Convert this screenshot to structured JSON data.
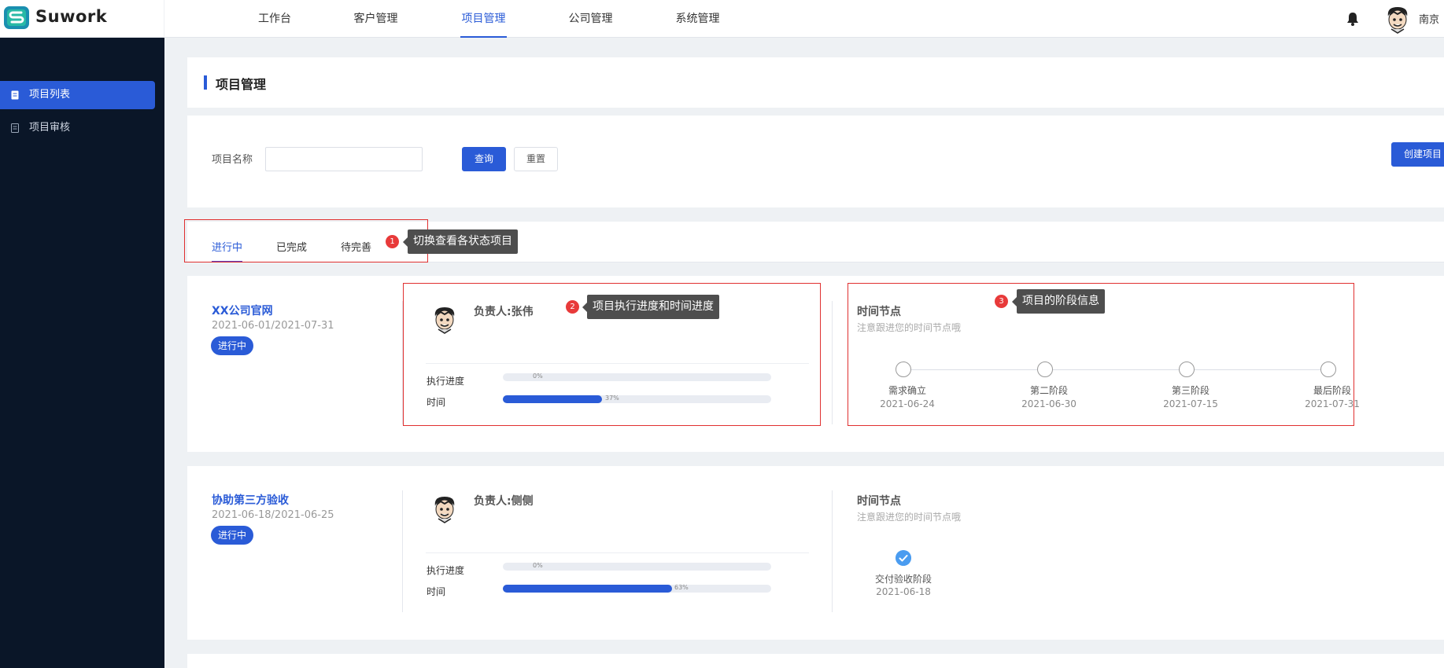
{
  "app": {
    "logo_text": "Suwork",
    "user_name": "南京"
  },
  "topnav": {
    "items": [
      {
        "label": "工作台",
        "active": false
      },
      {
        "label": "客户管理",
        "active": false
      },
      {
        "label": "项目管理",
        "active": true
      },
      {
        "label": "公司管理",
        "active": false
      },
      {
        "label": "系统管理",
        "active": false
      }
    ]
  },
  "sidebar": {
    "items": [
      {
        "label": "项目列表",
        "active": true
      },
      {
        "label": "项目审核",
        "active": false
      }
    ]
  },
  "page": {
    "title": "项目管理"
  },
  "filter": {
    "name_label": "项目名称",
    "name_value": "",
    "name_placeholder": "",
    "query_button": "查询",
    "reset_button": "重置",
    "create_button": "创建项目"
  },
  "tabs": [
    {
      "label": "进行中",
      "active": true
    },
    {
      "label": "已完成",
      "active": false
    },
    {
      "label": "待完善",
      "active": false
    }
  ],
  "annotations": [
    {
      "number": "1",
      "text": "切换查看各状态项目"
    },
    {
      "number": "2",
      "text": "项目执行进度和时间进度"
    },
    {
      "number": "3",
      "text": "项目的阶段信息"
    }
  ],
  "projects": [
    {
      "name": "XX公司官网",
      "dates": "2021-06-01/2021-07-31",
      "status": "进行中",
      "owner": "负责人:张伟",
      "exec_label": "执行进度",
      "exec_percent": 0,
      "exec_text": "0%",
      "time_label": "时间",
      "time_percent": 37,
      "time_text": "37%",
      "timeline_title": "时间节点",
      "timeline_subtitle": "注意跟进您的时间节点哦",
      "stages": [
        {
          "name": "需求确立",
          "date": "2021-06-24",
          "done": false
        },
        {
          "name": "第二阶段",
          "date": "2021-06-30",
          "done": false
        },
        {
          "name": "第三阶段",
          "date": "2021-07-15",
          "done": false
        },
        {
          "name": "最后阶段",
          "date": "2021-07-31",
          "done": false
        }
      ]
    },
    {
      "name": "协助第三方验收",
      "dates": "2021-06-18/2021-06-25",
      "status": "进行中",
      "owner": "负责人:侧侧",
      "exec_label": "执行进度",
      "exec_percent": 0,
      "exec_text": "0%",
      "time_label": "时间",
      "time_percent": 63,
      "time_text": "63%",
      "timeline_title": "时间节点",
      "timeline_subtitle": "注意跟进您的时间节点哦",
      "stages": [
        {
          "name": "交付验收阶段",
          "date": "2021-06-18",
          "done": true
        }
      ]
    }
  ],
  "colors": {
    "accent": "#2a5bd7",
    "sidebar_bg": "#0a1628",
    "annotation_red": "#e03030",
    "page_bg": "#eef1f4"
  },
  "icons": {
    "bell": "bell-icon",
    "avatar": "cartoon-avatar",
    "list": "document-icon",
    "audit": "audit-icon",
    "check": "check-icon"
  }
}
